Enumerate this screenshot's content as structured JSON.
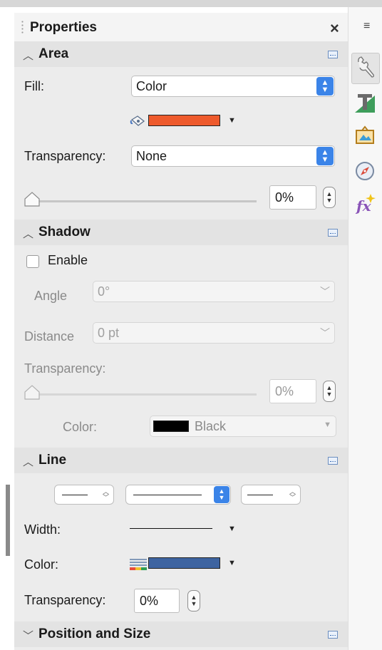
{
  "sidebar": {
    "title": "Properties",
    "close_glyph": "×",
    "menu_glyph": "≡"
  },
  "area": {
    "title": "Area",
    "fill_label": "Fill:",
    "fill_value": "Color",
    "fill_color": "#ee5a2c",
    "transparency_label": "Transparency:",
    "transparency_mode": "None",
    "transparency_percent": "0%",
    "transparency_level": 0
  },
  "shadow": {
    "title": "Shadow",
    "enable_label": "Enable",
    "enabled": false,
    "angle_label": "Angle",
    "angle_value": "0°",
    "distance_label": "Distance",
    "distance_value": "0 pt",
    "transparency_label": "Transparency:",
    "transparency_percent": "0%",
    "transparency_level": 0,
    "color_label": "Color:",
    "color_name": "Black",
    "color_hex": "#000000"
  },
  "line": {
    "title": "Line",
    "width_label": "Width:",
    "color_label": "Color:",
    "color_hex": "#3e64a1",
    "transparency_label": "Transparency:",
    "transparency_percent": "0%"
  },
  "position": {
    "title": "Position and Size"
  },
  "tabs": [
    {
      "name": "properties",
      "icon": "wrench-icon"
    },
    {
      "name": "styles",
      "icon": "styles-icon"
    },
    {
      "name": "gallery",
      "icon": "gallery-icon"
    },
    {
      "name": "navigator",
      "icon": "navigator-icon"
    },
    {
      "name": "functions",
      "icon": "functions-icon"
    }
  ]
}
